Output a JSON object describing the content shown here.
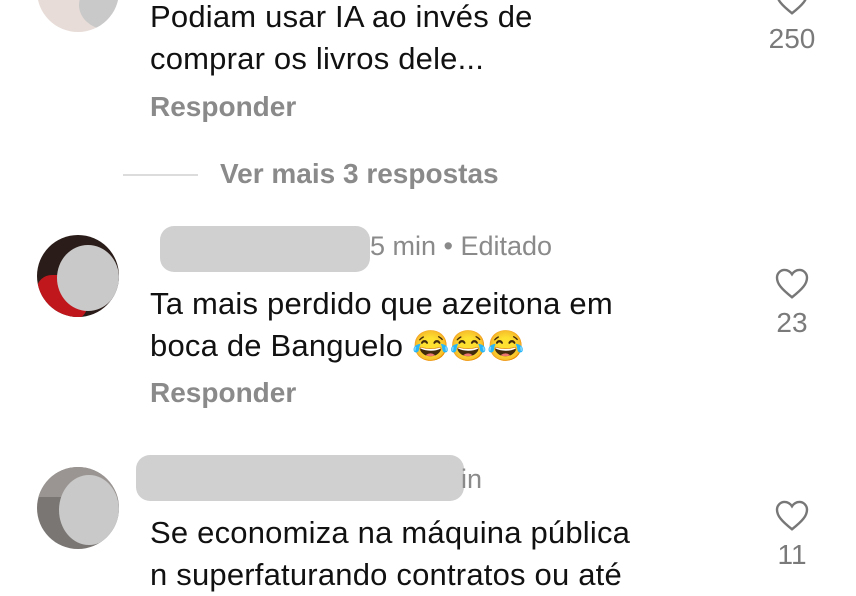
{
  "comments": [
    {
      "text_lines": [
        "Podiam usar IA ao invés de",
        "comprar os livros dele..."
      ],
      "reply_label": "Responder",
      "likes": "250",
      "heart_icon": "heart-outline"
    },
    {
      "time": "5 min",
      "edited": "• Editado",
      "text_lines": [
        "Ta mais perdido que azeitona em",
        "boca de Banguelo"
      ],
      "emojis": "😂😂😂",
      "reply_label": "Responder",
      "likes": "23",
      "heart_icon": "heart-outline"
    },
    {
      "time": "in",
      "text_lines": [
        "Se economiza na máquina pública",
        "n superfaturando contratos ou até"
      ],
      "likes": "11",
      "heart_icon": "heart-outline"
    }
  ],
  "view_more": "Ver mais 3 respostas"
}
